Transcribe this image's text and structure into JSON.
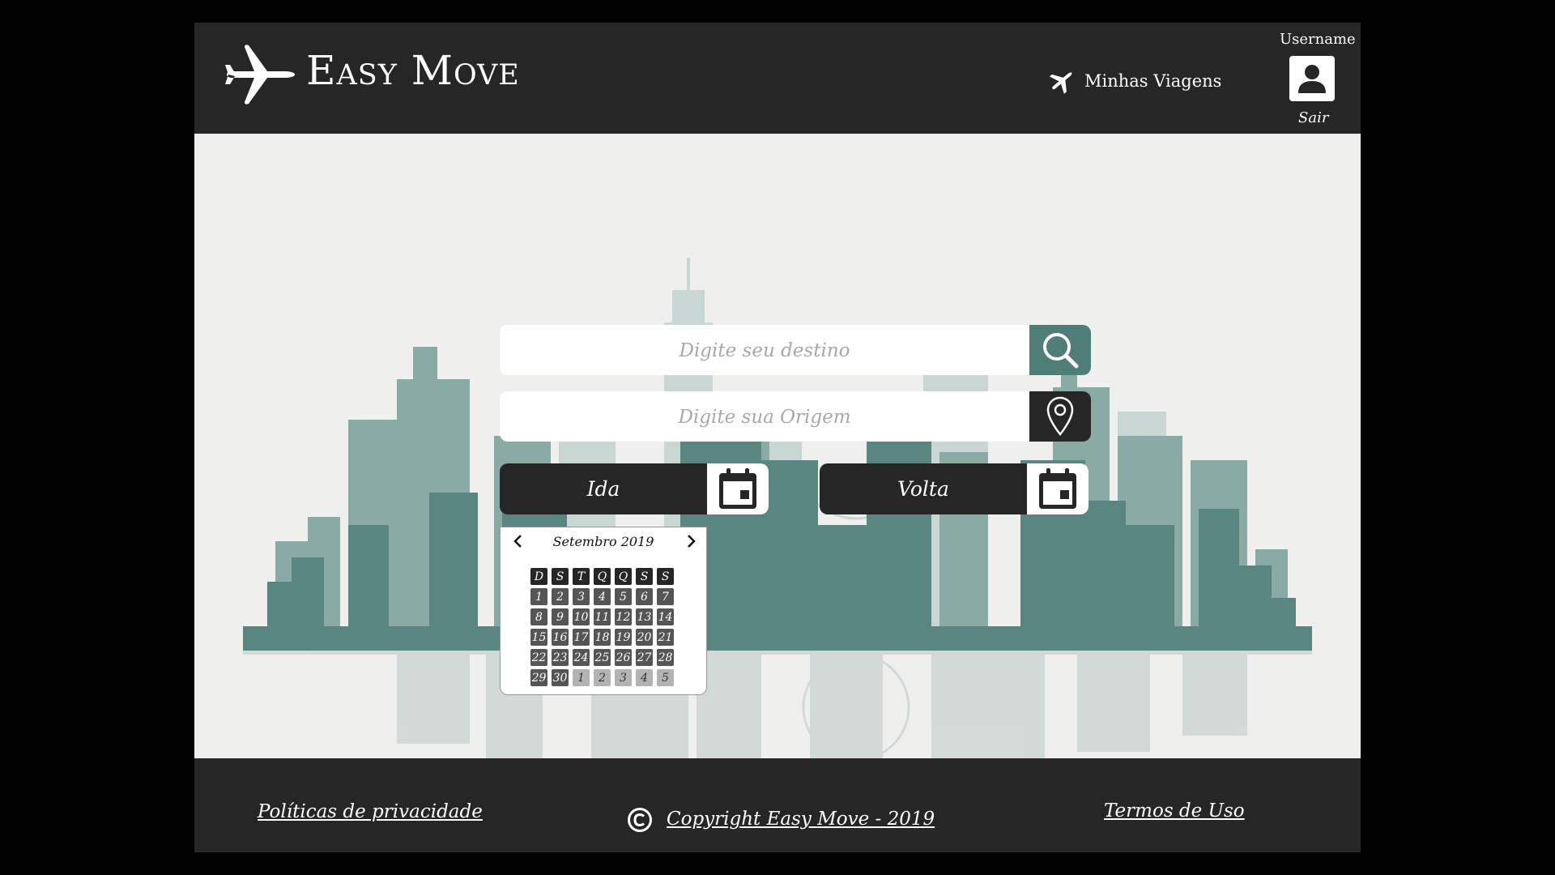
{
  "header": {
    "brand": "Easy Move",
    "trips_label": "Minhas Viagens",
    "username": "Username",
    "logout_label": "Sair"
  },
  "search": {
    "destination_placeholder": "Digite seu destino",
    "destination_value": "",
    "origin_placeholder": "Digite sua Origem",
    "origin_value": "",
    "depart_label": "Ida",
    "return_label": "Volta"
  },
  "calendar": {
    "month": "Setembro 2019",
    "weekdays": [
      "D",
      "S",
      "T",
      "Q",
      "Q",
      "S",
      "S"
    ],
    "weeks": [
      [
        "1",
        "2",
        "3",
        "4",
        "5",
        "6",
        "7"
      ],
      [
        "8",
        "9",
        "10",
        "11",
        "12",
        "13",
        "14"
      ],
      [
        "15",
        "16",
        "17",
        "18",
        "19",
        "20",
        "21"
      ],
      [
        "22",
        "23",
        "24",
        "25",
        "26",
        "27",
        "28"
      ],
      [
        "29",
        "30",
        "1",
        "2",
        "3",
        "4",
        "5"
      ]
    ],
    "next_month_days_in_last_week": 5
  },
  "footer": {
    "privacy": "Políticas de privacidade",
    "copyright": "Copyright Easy Move - 2019",
    "terms": "Termos de Uso"
  },
  "colors": {
    "dark": "#262626",
    "accent": "#4f7d78",
    "background": "#efefed"
  },
  "icons": {
    "logo": "airplane-icon",
    "trips": "airplane-icon",
    "user": "user-icon",
    "destination_button": "search-icon",
    "origin_button": "map-pin-icon",
    "date_button": "calendar-icon",
    "copyright": "copyright-icon"
  }
}
